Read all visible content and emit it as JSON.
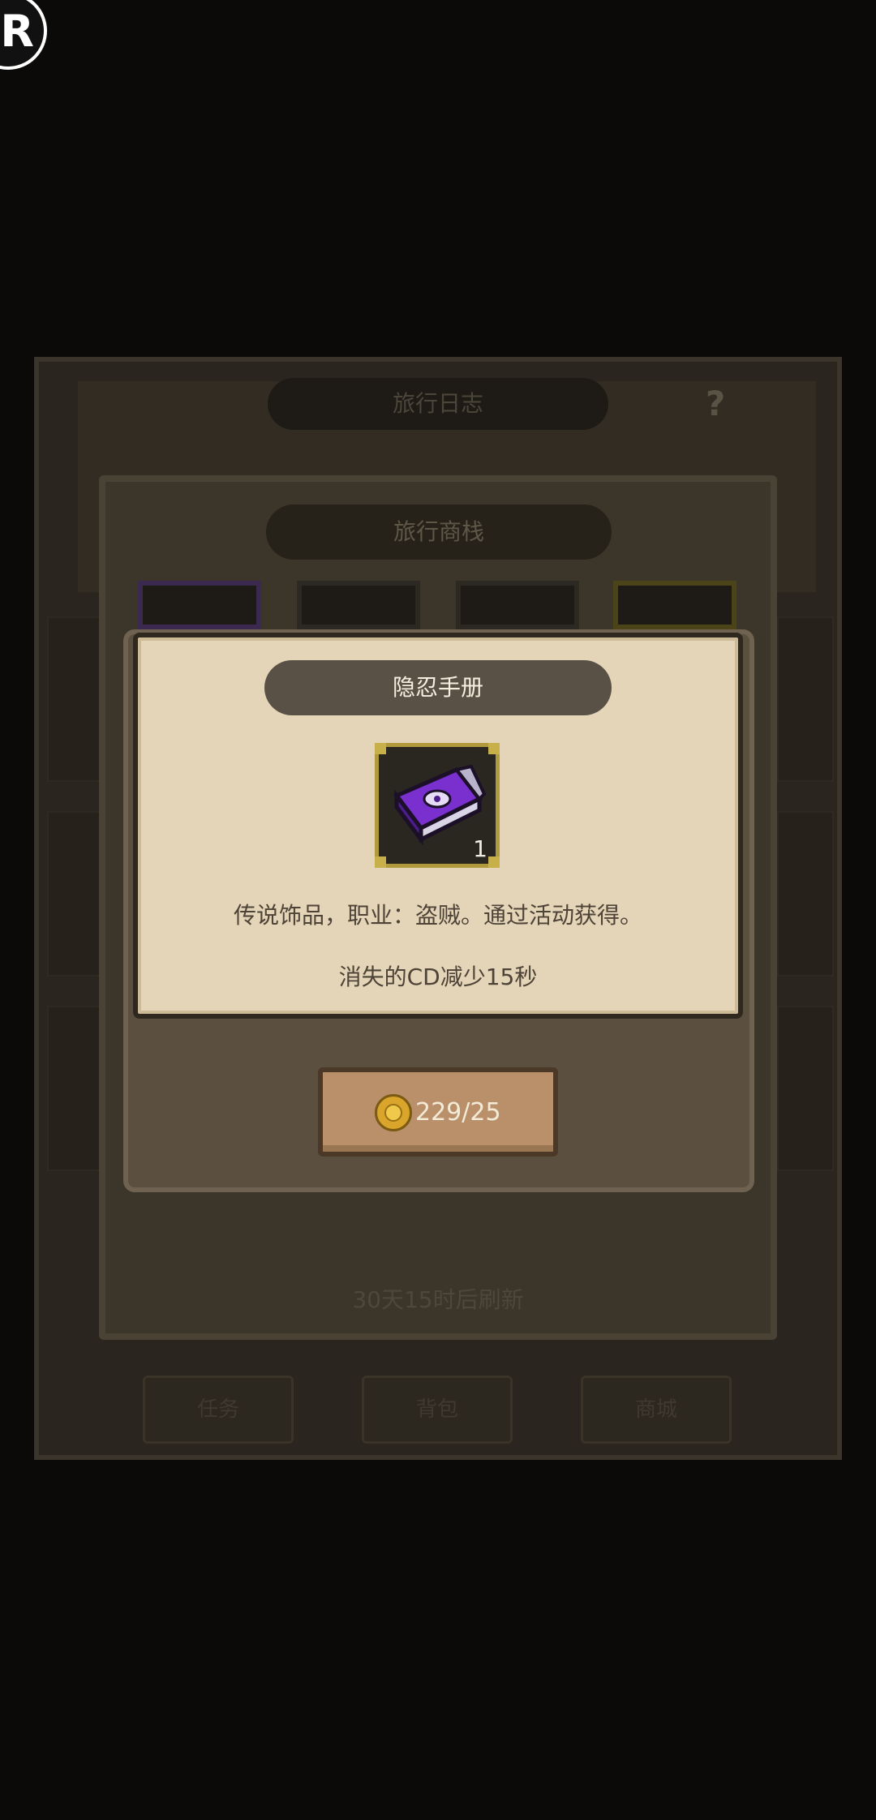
{
  "recording_badge": "R",
  "journal": {
    "title": "旅行日志",
    "help_icon": "?",
    "tabs": [
      "任务",
      "背包",
      "商城"
    ]
  },
  "shop": {
    "title": "旅行商栈",
    "refresh_text": "30天15时后刷新"
  },
  "detail": {
    "title": "隐忍手册",
    "item_icon": "purple-book-icon",
    "item_count": "1",
    "description": "传说饰品，职业：盗贼。通过活动获得。",
    "effect": "消失的CD减少15秒",
    "price": "229/25",
    "currency_icon": "gold-coin-icon"
  },
  "colors": {
    "card_bg": "#e4d5b8",
    "title_bar": "#5a5146",
    "button": "#b9906a",
    "gold": "#d9a52a",
    "rare_purple": "#7a2fcf"
  }
}
